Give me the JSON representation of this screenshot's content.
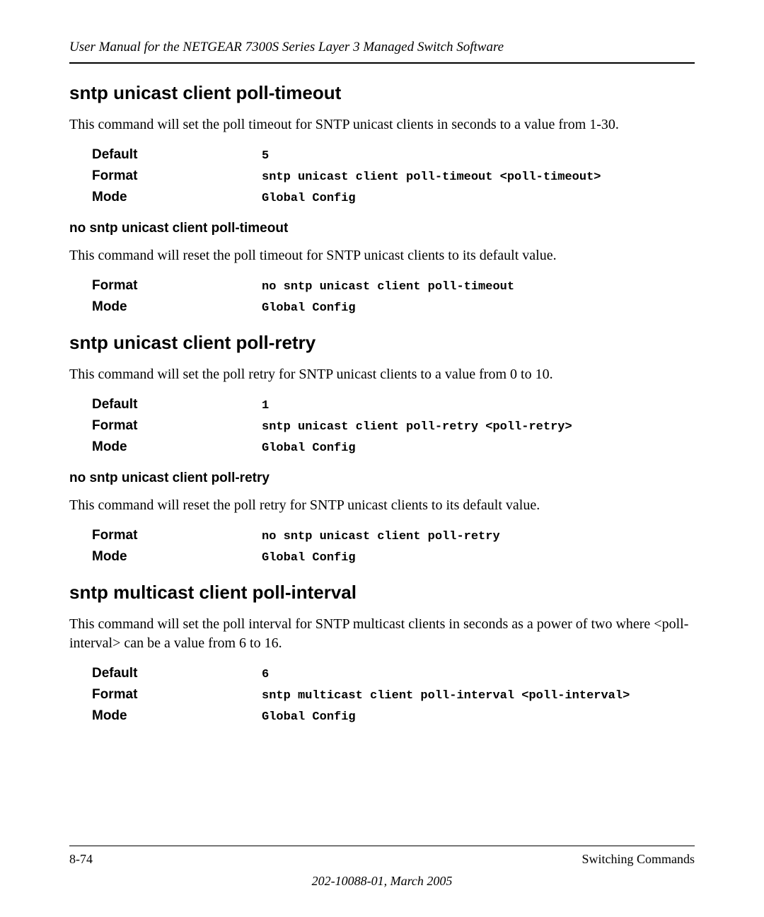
{
  "header": {
    "title": "User Manual for the NETGEAR 7300S Series Layer 3 Managed Switch Software"
  },
  "sections": [
    {
      "heading": "sntp unicast client poll-timeout",
      "description": "This command will set the poll timeout for SNTP unicast clients in seconds to a value from 1-30.",
      "rows": [
        {
          "label": "Default",
          "value": "5"
        },
        {
          "label": "Format",
          "value": "sntp unicast client poll-timeout <poll-timeout>"
        },
        {
          "label": "Mode",
          "value": "Global Config"
        }
      ],
      "sub": {
        "heading": "no sntp unicast client poll-timeout",
        "description": "This command will reset the poll timeout for SNTP unicast clients to its default value.",
        "rows": [
          {
            "label": "Format",
            "value": "no sntp unicast client poll-timeout"
          },
          {
            "label": "Mode",
            "value": "Global Config"
          }
        ]
      }
    },
    {
      "heading": "sntp unicast client poll-retry",
      "description": "This command will set the poll retry for SNTP unicast clients to a value from 0 to 10.",
      "rows": [
        {
          "label": "Default",
          "value": "1"
        },
        {
          "label": "Format",
          "value": "sntp unicast client poll-retry <poll-retry>"
        },
        {
          "label": "Mode",
          "value": "Global Config"
        }
      ],
      "sub": {
        "heading": "no sntp unicast client poll-retry",
        "description": "This command will reset the poll retry for SNTP unicast clients to its default value.",
        "rows": [
          {
            "label": "Format",
            "value": "no sntp unicast client poll-retry"
          },
          {
            "label": "Mode",
            "value": "Global Config"
          }
        ]
      }
    },
    {
      "heading": "sntp multicast client poll-interval",
      "description": "This command will set the poll interval for SNTP multicast clients in seconds as a power of two where <poll-interval> can be a value from 6 to 16.",
      "rows": [
        {
          "label": "Default",
          "value": "6"
        },
        {
          "label": "Format",
          "value": "sntp multicast client poll-interval <poll-interval>"
        },
        {
          "label": "Mode",
          "value": "Global Config"
        }
      ]
    }
  ],
  "footer": {
    "left": "8-74",
    "right": "Switching Commands",
    "center": "202-10088-01, March 2005"
  }
}
